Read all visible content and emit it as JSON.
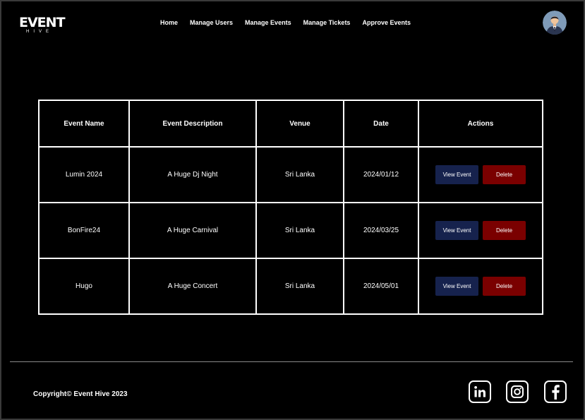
{
  "brand": {
    "logo_main": "EVENT",
    "logo_sub": "HIVE"
  },
  "nav": [
    "Home",
    "Manage Users",
    "Manage Events",
    "Manage Tickets",
    "Approve Events"
  ],
  "table": {
    "headers": [
      "Event Name",
      "Event Description",
      "Venue",
      "Date",
      "Actions"
    ],
    "rows": [
      {
        "name": "Lumin 2024",
        "description": "A Huge Dj Night",
        "venue": "Sri Lanka",
        "date": "2024/01/12"
      },
      {
        "name": "BonFire24",
        "description": "A Huge Carnival",
        "venue": "Sri Lanka",
        "date": "2024/03/25"
      },
      {
        "name": "Hugo",
        "description": "A Huge Concert",
        "venue": "Sri Lanka",
        "date": "2024/05/01"
      }
    ],
    "view_label": "View Event",
    "delete_label": "Delete"
  },
  "footer": {
    "copyright": "Copyright© Event Hive 2023"
  },
  "social_icons": [
    "linkedin-icon",
    "instagram-icon",
    "facebook-icon"
  ],
  "colors": {
    "view_button": "#16224d",
    "delete_button": "#7a0000",
    "background": "#000000"
  }
}
